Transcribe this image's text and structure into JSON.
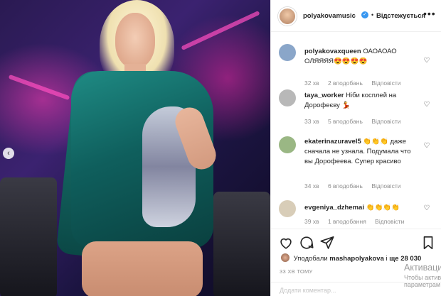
{
  "post": {
    "author": "polyakovamusic",
    "verified_mark": "✓",
    "separator": "•",
    "follow_status": "Відстежується",
    "more_icon": "•••",
    "carousel_prev": "‹"
  },
  "comments": [
    {
      "username": "polyakovaxqueen",
      "text": "ОАОАОАО ОЛЯЯЯЯ😍😍😍😍",
      "time": "32 хв",
      "likes": "2 вподобань",
      "reply": "Відповісти",
      "avatar_color": "#8aa6c9"
    },
    {
      "username": "taya_worker",
      "text": "Ніби косплей на Дорофеєву 💃",
      "time": "33 хв",
      "likes": "5 вподобань",
      "reply": "Відповісти",
      "avatar_color": "#b8b8b8"
    },
    {
      "username": "ekaterinazuravel5",
      "text": "👏👏👏 даже сначала не узнала. Подумала что вы Дорофеева. Супер красиво",
      "time": "34 хв",
      "likes": "6 вподобань",
      "reply": "Відповісти",
      "avatar_color": "#9ab784"
    },
    {
      "username": "evgeniya_dzhemai",
      "text": "👏👏👏👏",
      "time": "39 хв",
      "likes": "1 вподобання",
      "reply": "Відповісти",
      "avatar_color": "#d8cdb8"
    }
  ],
  "likes": {
    "prefix": "Уподобали",
    "user": "mashapolyakova",
    "and": "і",
    "others": "ще 28 030"
  },
  "posted_ago": "33 ХВ ТОМУ",
  "add_comment_placeholder": "Додати коментар...",
  "watermark": {
    "line1": "Активаци",
    "line2": "Чтобы активи",
    "line3": "параметрам"
  },
  "colors": {
    "verified": "#3897f0",
    "meta_text": "#8e8e8e",
    "primary_text": "#262626"
  }
}
